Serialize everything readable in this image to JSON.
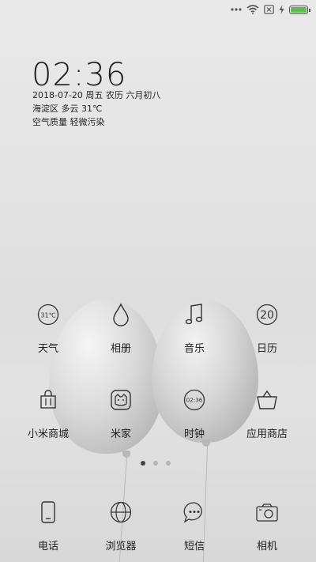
{
  "status_bar": {
    "icons": [
      "more-dots-icon",
      "wifi-icon",
      "no-sim-icon",
      "charging-icon",
      "battery-icon"
    ],
    "battery_color": "#58c24a",
    "battery_level": 1.0
  },
  "lock": {
    "time": "02:36",
    "date_line": "2018-07-20 周五 农历 六月初八",
    "weather_line": "海淀区 多云 31℃",
    "air_line": "空气质量 轻微污染"
  },
  "apps_row1": [
    {
      "label": "天气",
      "icon": "weather-icon",
      "icon_text": "31℃"
    },
    {
      "label": "相册",
      "icon": "gallery-icon"
    },
    {
      "label": "音乐",
      "icon": "music-icon"
    },
    {
      "label": "日历",
      "icon": "calendar-icon",
      "icon_text": "20"
    }
  ],
  "apps_row2": [
    {
      "label": "小米商城",
      "icon": "mi-store-icon"
    },
    {
      "label": "米家",
      "icon": "mijia-icon"
    },
    {
      "label": "时钟",
      "icon": "clock-icon",
      "icon_text": "02:36"
    },
    {
      "label": "应用商店",
      "icon": "app-store-icon"
    }
  ],
  "page_indicator": {
    "count": 3,
    "active": 1
  },
  "dock": [
    {
      "label": "电话",
      "icon": "phone-icon"
    },
    {
      "label": "浏览器",
      "icon": "browser-icon"
    },
    {
      "label": "短信",
      "icon": "messages-icon"
    },
    {
      "label": "相机",
      "icon": "camera-icon"
    }
  ]
}
